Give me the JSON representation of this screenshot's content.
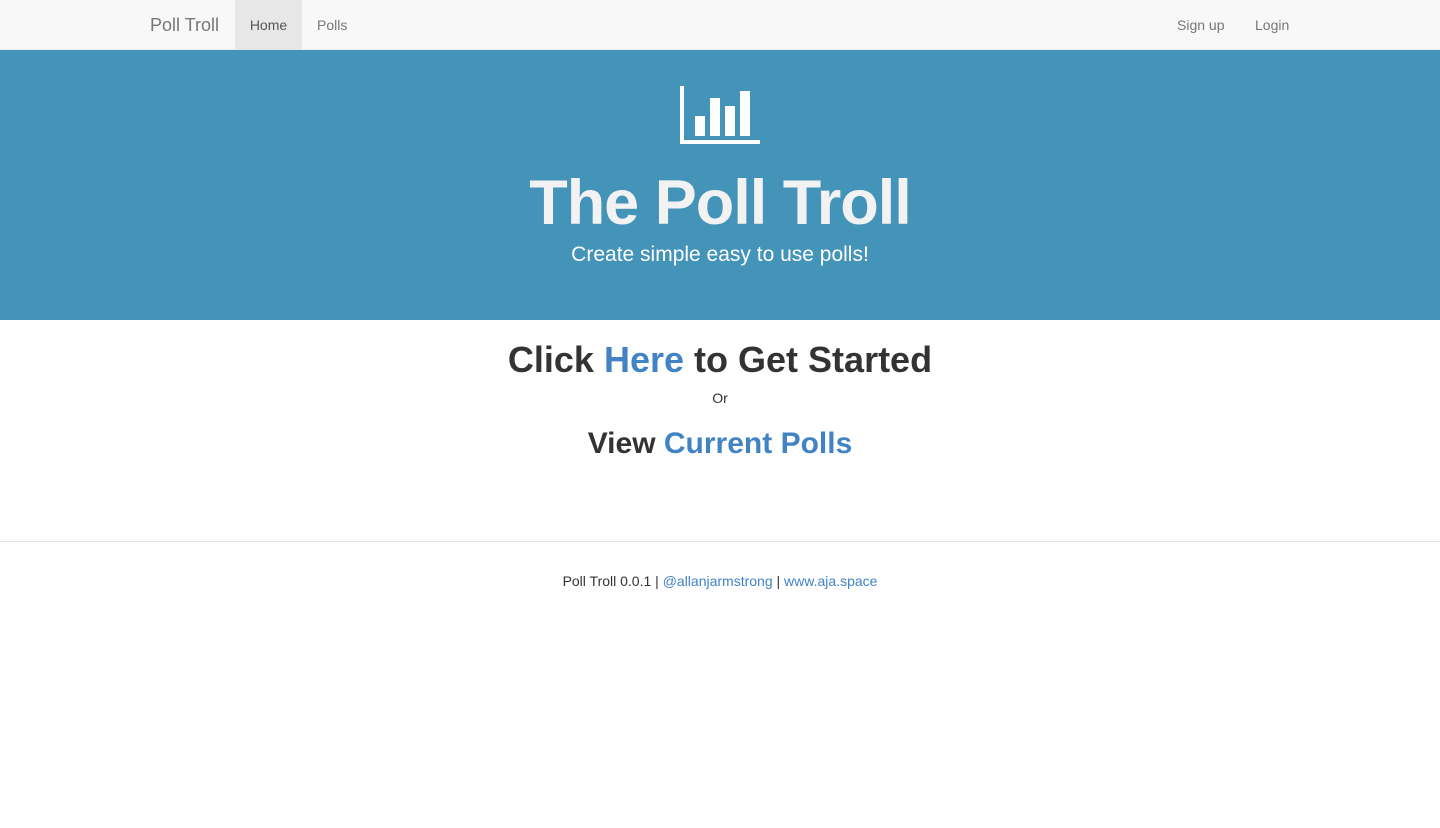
{
  "navbar": {
    "brand": "Poll Troll",
    "left_items": [
      {
        "label": "Home",
        "active": true
      },
      {
        "label": "Polls",
        "active": false
      }
    ],
    "right_items": [
      {
        "label": "Sign up"
      },
      {
        "label": "Login"
      }
    ]
  },
  "hero": {
    "icon": "bar-chart-icon",
    "title": "The Poll Troll",
    "subtitle": "Create simple easy to use polls!",
    "background_color": "#4493b9"
  },
  "cta": {
    "start_prefix": "Click",
    "start_link": "Here",
    "start_suffix": "to Get Started",
    "or_text": "Or",
    "view_prefix": "View",
    "view_link": "Current Polls"
  },
  "footer": {
    "version_text": "Poll Troll 0.0.1",
    "separator": "|",
    "twitter_link": "@allanjarmstrong",
    "website_link": "www.aja.space"
  },
  "colors": {
    "link": "#4283c5",
    "navbar_bg": "#f8f8f8",
    "nav_active_bg": "#e7e7e7"
  }
}
